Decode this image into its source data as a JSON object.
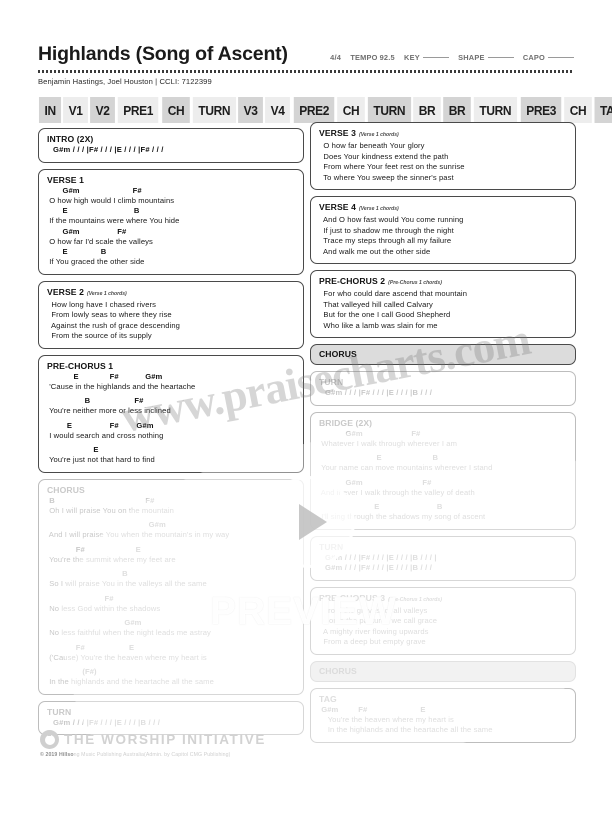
{
  "header": {
    "title": "Highlands (Song of Ascent)",
    "byline": "Benjamin Hastings, Joel Houston  | CCLI: 7122399",
    "meter": "4/4",
    "tempo_label": "TEMPO",
    "tempo_value": "92.5",
    "key_label": "KEY",
    "shape_label": "SHAPE",
    "capo_label": "CAPO"
  },
  "arrangement": [
    {
      "label": "IN",
      "shade": "a"
    },
    {
      "label": "V1",
      "shade": "b"
    },
    {
      "label": "V2",
      "shade": "a"
    },
    {
      "label": "PRE1",
      "shade": "b"
    },
    {
      "label": "CH",
      "shade": "a"
    },
    {
      "label": "TURN",
      "shade": "b"
    },
    {
      "label": "V3",
      "shade": "a"
    },
    {
      "label": "V4",
      "shade": "b"
    },
    {
      "label": "PRE2",
      "shade": "a"
    },
    {
      "label": "CH",
      "shade": "b"
    },
    {
      "label": "TURN",
      "shade": "a"
    },
    {
      "label": "BR",
      "shade": "b"
    },
    {
      "label": "BR",
      "shade": "a"
    },
    {
      "label": "TURN",
      "shade": "b"
    },
    {
      "label": "PRE3",
      "shade": "a"
    },
    {
      "label": "CH",
      "shade": "b"
    },
    {
      "label": "TAG",
      "shade": "a"
    }
  ],
  "left_column": {
    "intro": {
      "label": "INTRO (2X)",
      "progression": "G#m / / / |F# / / / |E / / / |F# / / /"
    },
    "verse1": {
      "label": "VERSE 1",
      "lines": [
        {
          "chords": "       G#m                        F#",
          "lyric": " O how high would I climb mountains"
        },
        {
          "chords": "       E                              B",
          "lyric": " If the mountains were where You hide"
        },
        {
          "chords": "       G#m                 F#",
          "lyric": " O how far I'd scale the valleys"
        },
        {
          "chords": "       E               B",
          "lyric": " If You graced the other side"
        }
      ]
    },
    "verse2": {
      "label": "VERSE 2",
      "note": "(Verse 1 chords)",
      "lines": [
        "  How long have I chased rivers",
        "  From lowly seas to where they rise",
        "  Against the rush of grace descending",
        "  From the source of its supply"
      ]
    },
    "prechorus1": {
      "label": "PRE-CHORUS 1",
      "lines": [
        {
          "chords": "            E              F#            G#m",
          "lyric": " 'Cause in the highlands and the heartache"
        },
        {
          "chords": "                 B                    F#",
          "lyric": " You're neither more or less inclined"
        },
        {
          "chords": "         E                 F#        G#m",
          "lyric": " I would search and cross nothing"
        },
        {
          "chords": "                     E",
          "lyric": " You're just not that hard to find"
        }
      ]
    },
    "chorus": {
      "label": "CHORUS",
      "lines": [
        {
          "chords": " B                                         F#",
          "lyric": " Oh I will praise You on the mountain"
        },
        {
          "chords": "                                              G#m",
          "lyric": " And I will praise You when the mountain's in my way"
        },
        {
          "chords": "             F#                       E",
          "lyric": " You're the summit where my feet are"
        },
        {
          "chords": "                                  B",
          "lyric": " So I will praise You in the valleys all the same"
        },
        {
          "chords": "                          F#",
          "lyric": " No less God within the shadows"
        },
        {
          "chords": "                                   G#m",
          "lyric": " No less faithful when the night leads me astray"
        },
        {
          "chords": "             F#                    E",
          "lyric": " ('Cause) You're the heaven where my heart is"
        },
        {
          "chords": "                (F#)",
          "lyric": " In the highlands and the heartache all the same"
        }
      ]
    },
    "turn": {
      "label": "TURN",
      "progression": "G#m / / / |F# / / / |E / / / |B / / /"
    }
  },
  "right_column": {
    "verse3": {
      "label": "VERSE 3",
      "note": "(Verse 1 chords)",
      "lines": [
        "  O how far beneath Your glory",
        "  Does Your kindness extend the path",
        "  From where Your feet rest on the sunrise",
        "  To where You sweep the sinner's past"
      ]
    },
    "verse4": {
      "label": "VERSE 4",
      "note": "(Verse 1 chords)",
      "lines": [
        "  And O how fast would You come running",
        "  If just to shadow me through the night",
        "  Trace my steps through all my failure",
        "  And walk me out the other side"
      ]
    },
    "prechorus2": {
      "label": "PRE-CHORUS 2",
      "note": "(Pre-Chorus 1 chords)",
      "lines": [
        "  For who could dare ascend that mountain",
        "  That valleyed hill called Calvary",
        "  But for the one I call Good Shepherd",
        "  Who like a lamb was slain for me"
      ]
    },
    "chorus_ref_1": {
      "label": "CHORUS"
    },
    "turn_1": {
      "label": "TURN",
      "progression": "G#m / / / |F# / / / |E / / / |B / / /"
    },
    "bridge": {
      "label": "BRIDGE (2X)",
      "lines": [
        {
          "chords": "            G#m                      F#",
          "lyric": " Whatever I walk through wherever I am"
        },
        {
          "chords": "                          E                       B",
          "lyric": " Your name can move mountains wherever I stand"
        },
        {
          "chords": "            G#m                           F#",
          "lyric": " And if ever I walk through the valley of death"
        },
        {
          "chords": "                         E                          B",
          "lyric": " I'll sing through the shadows my song of ascent"
        }
      ]
    },
    "turn_2": {
      "label": "TURN",
      "progression_line1": "G#m / / / |F# / / / |E / / / |B / / / |",
      "progression_line2": "G#m / / / |F# / / / |E / / / |B / / /"
    },
    "prechorus3": {
      "label": "PRE-CHORUS 3",
      "note": "(Pre-Chorus 1 chords)",
      "lines": [
        "  From the gravest of all valleys",
        "  Come the pastures we call grace",
        "  A mighty river flowing upwards",
        "  From a deep but empty grave"
      ]
    },
    "chorus_ref_2": {
      "label": "CHORUS"
    },
    "tag": {
      "label": "TAG",
      "lines": [
        {
          "chords": " G#m         F#                        E",
          "lyric": "    You're the heaven where my heart is"
        },
        {
          "chords": "",
          "lyric": "    In the highlands and the heartache all the same"
        }
      ]
    }
  },
  "footer": {
    "brand": "THE WORSHIP INITIATIVE",
    "copyright_bold": "© 2019 Hillso",
    "copyright_rest": "ng Music Publishing Australia(Admin. by Capitol CMG Publishing)"
  },
  "watermarks": {
    "url": "www.praisecharts.com",
    "preview": "PREVIEW"
  },
  "colors": {
    "arr_dark": "#d4d4d4",
    "arr_light": "#ededed",
    "border": "#4a4a4a",
    "text": "#111111",
    "dim": "#c9c9c9"
  }
}
